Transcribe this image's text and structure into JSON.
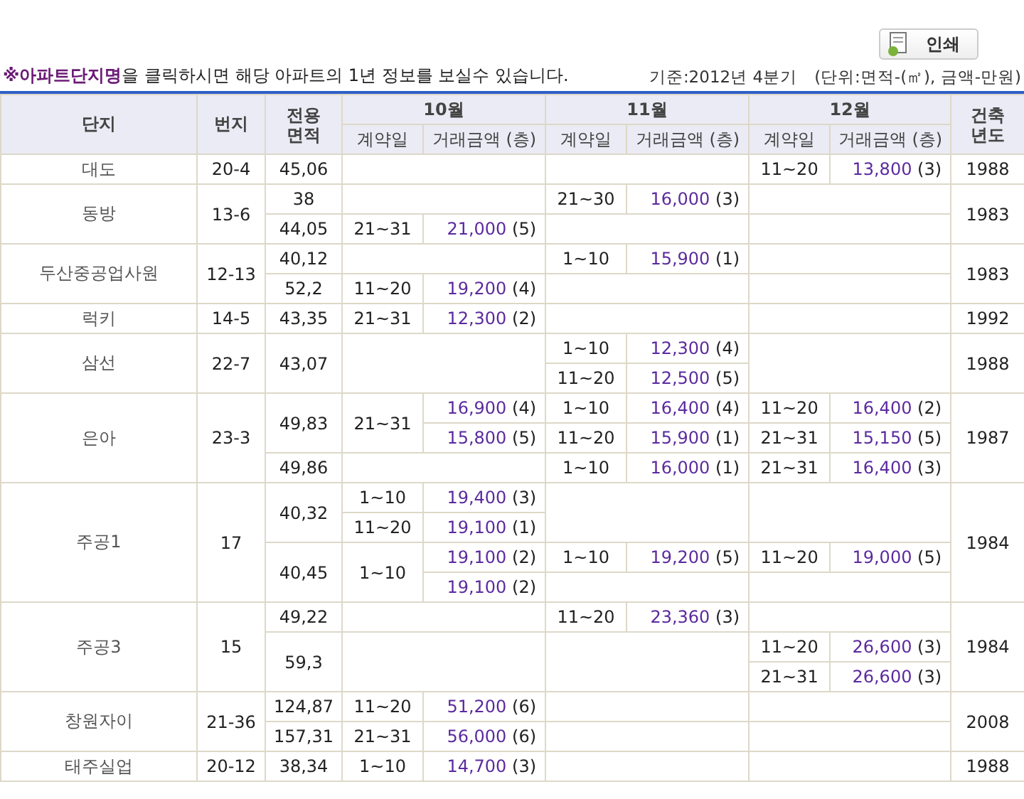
{
  "print_button": {
    "label": "인쇄"
  },
  "notice": "**※아파트단지명**을 클릭하시면 해당 아파트의 1년 정보를 보실수 있습니다.",
  "basis": "기준:2012년 4분기",
  "unit": "(단위:면적-(㎡), 금액-만원)",
  "columns": {
    "complex": "단지",
    "lot": "번지",
    "area": "전용\n면적",
    "year": "건축\n년도",
    "months": [
      {
        "label": "10월",
        "day": "계약일",
        "amount": "거래금액 (층)"
      },
      {
        "label": "11월",
        "day": "계약일",
        "amount": "거래금액 (층)"
      },
      {
        "label": "12월",
        "day": "계약일",
        "amount": "거래금액 (층)"
      }
    ]
  },
  "complexes": [
    {
      "name": "대도",
      "lot": "20-4",
      "year": "1988",
      "sizes": [
        {
          "area": "45,06",
          "dec": [
            {
              "day": "11~20",
              "deals": [
                {
                  "price": "13,800",
                  "floor": "(3)"
                }
              ]
            }
          ]
        }
      ]
    },
    {
      "name": "동방",
      "lot": "13-6",
      "year": "1983",
      "sizes": [
        {
          "area": "38",
          "nov": [
            {
              "day": "21~30",
              "deals": [
                {
                  "price": "16,000",
                  "floor": "(3)"
                }
              ]
            }
          ]
        },
        {
          "area": "44,05",
          "oct": [
            {
              "day": "21~31",
              "deals": [
                {
                  "price": "21,000",
                  "floor": "(5)"
                }
              ]
            }
          ]
        }
      ]
    },
    {
      "name": "두산중공업사원",
      "lot": "12-13",
      "year": "1983",
      "sizes": [
        {
          "area": "40,12",
          "nov": [
            {
              "day": "1~10",
              "deals": [
                {
                  "price": "15,900",
                  "floor": "(1)"
                }
              ]
            }
          ]
        },
        {
          "area": "52,2",
          "oct": [
            {
              "day": "11~20",
              "deals": [
                {
                  "price": "19,200",
                  "floor": "(4)"
                }
              ]
            }
          ]
        }
      ]
    },
    {
      "name": "럭키",
      "lot": "14-5",
      "year": "1992",
      "sizes": [
        {
          "area": "43,35",
          "oct": [
            {
              "day": "21~31",
              "deals": [
                {
                  "price": "12,300",
                  "floor": "(2)"
                }
              ]
            }
          ]
        }
      ]
    },
    {
      "name": "삼선",
      "lot": "22-7",
      "year": "1988",
      "sizes": [
        {
          "area": "43,07",
          "nov": [
            {
              "day": "1~10",
              "deals": [
                {
                  "price": "12,300",
                  "floor": "(4)"
                }
              ]
            },
            {
              "day": "11~20",
              "deals": [
                {
                  "price": "12,500",
                  "floor": "(5)"
                }
              ]
            }
          ]
        }
      ]
    },
    {
      "name": "은아",
      "lot": "23-3",
      "year": "1987",
      "sizes": [
        {
          "area": "49,83",
          "oct": [
            {
              "day": "21~31",
              "deals": [
                {
                  "price": "16,900",
                  "floor": "(4)"
                },
                {
                  "price": "15,800",
                  "floor": "(5)"
                }
              ]
            }
          ],
          "nov": [
            {
              "day": "1~10",
              "deals": [
                {
                  "price": "16,400",
                  "floor": "(4)"
                }
              ]
            },
            {
              "day": "11~20",
              "deals": [
                {
                  "price": "15,900",
                  "floor": "(1)"
                }
              ]
            }
          ],
          "dec": [
            {
              "day": "11~20",
              "deals": [
                {
                  "price": "16,400",
                  "floor": "(2)"
                }
              ]
            },
            {
              "day": "21~31",
              "deals": [
                {
                  "price": "15,150",
                  "floor": "(5)"
                }
              ]
            }
          ]
        },
        {
          "area": "49,86",
          "nov": [
            {
              "day": "1~10",
              "deals": [
                {
                  "price": "16,000",
                  "floor": "(1)"
                }
              ]
            }
          ],
          "dec": [
            {
              "day": "21~31",
              "deals": [
                {
                  "price": "16,400",
                  "floor": "(3)"
                }
              ]
            }
          ]
        }
      ]
    },
    {
      "name": "주공1",
      "lot": "17",
      "year": "1984",
      "sizes": [
        {
          "area": "40,32",
          "oct": [
            {
              "day": "1~10",
              "deals": [
                {
                  "price": "19,400",
                  "floor": "(3)"
                }
              ]
            },
            {
              "day": "11~20",
              "deals": [
                {
                  "price": "19,100",
                  "floor": "(1)"
                }
              ]
            }
          ]
        },
        {
          "area": "40,45",
          "oct": [
            {
              "day": "1~10",
              "deals": [
                {
                  "price": "19,100",
                  "floor": "(2)"
                },
                {
                  "price": "19,100",
                  "floor": "(2)"
                }
              ]
            }
          ],
          "nov": [
            {
              "day": "1~10",
              "deals": [
                {
                  "price": "19,200",
                  "floor": "(5)"
                }
              ]
            }
          ],
          "dec": [
            {
              "day": "11~20",
              "deals": [
                {
                  "price": "19,000",
                  "floor": "(5)"
                }
              ]
            }
          ]
        }
      ]
    },
    {
      "name": "주공3",
      "lot": "15",
      "year": "1984",
      "sizes": [
        {
          "area": "49,22",
          "nov": [
            {
              "day": "11~20",
              "deals": [
                {
                  "price": "23,360",
                  "floor": "(3)"
                }
              ]
            }
          ]
        },
        {
          "area": "59,3",
          "dec": [
            {
              "day": "11~20",
              "deals": [
                {
                  "price": "26,600",
                  "floor": "(3)"
                }
              ]
            },
            {
              "day": "21~31",
              "deals": [
                {
                  "price": "26,600",
                  "floor": "(3)"
                }
              ]
            }
          ]
        }
      ]
    },
    {
      "name": "창원자이",
      "lot": "21-36",
      "year": "2008",
      "sizes": [
        {
          "area": "124,87",
          "oct": [
            {
              "day": "11~20",
              "deals": [
                {
                  "price": "51,200",
                  "floor": "(6)"
                }
              ]
            }
          ]
        },
        {
          "area": "157,31",
          "oct": [
            {
              "day": "21~31",
              "deals": [
                {
                  "price": "56,000",
                  "floor": "(6)"
                }
              ]
            }
          ]
        }
      ]
    },
    {
      "name": "태주실업",
      "lot": "20-12",
      "year": "1988",
      "sizes": [
        {
          "area": "38,34",
          "oct": [
            {
              "day": "1~10",
              "deals": [
                {
                  "price": "14,700",
                  "floor": "(3)"
                }
              ]
            }
          ]
        }
      ]
    }
  ]
}
